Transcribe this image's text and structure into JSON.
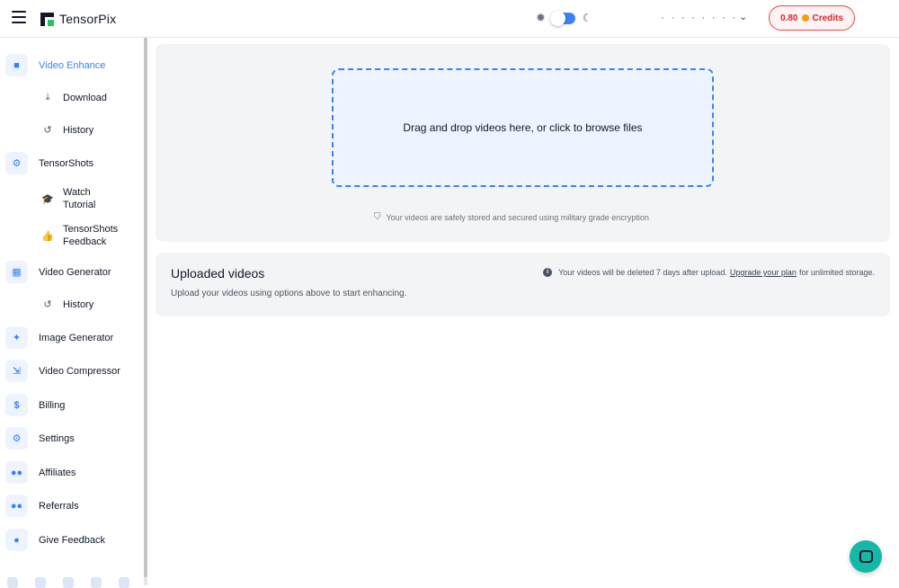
{
  "header": {
    "brand": "TensorPix",
    "user_name": "· · · · · · · ·",
    "credits_amount": "0.80",
    "credits_label": "Credits",
    "theme_mode": "light"
  },
  "sidebar": {
    "items": [
      {
        "label": "Video Enhance",
        "icon": "video-icon",
        "active": true
      },
      {
        "label": "Download",
        "icon": "download-icon"
      },
      {
        "label": "History",
        "icon": "history-icon"
      },
      {
        "label": "TensorShots",
        "icon": "gear-icon"
      },
      {
        "label": "Watch Tutorial",
        "line1": "Watch",
        "line2": "Tutorial",
        "icon": "graduation-cap-icon"
      },
      {
        "label": "TensorShots Feedback",
        "line1": "TensorShots",
        "line2": "Feedback",
        "icon": "thumbs-icon"
      },
      {
        "label": "Video Generator",
        "icon": "film-icon"
      },
      {
        "label": "History",
        "icon": "history-icon"
      },
      {
        "label": "Image Generator",
        "icon": "magic-wand-icon"
      },
      {
        "label": "Video Compressor",
        "icon": "compress-icon"
      },
      {
        "label": "Billing",
        "icon": "dollar-icon"
      },
      {
        "label": "Settings",
        "icon": "settings-icon"
      },
      {
        "label": "Affiliates",
        "icon": "users-icon"
      },
      {
        "label": "Referrals",
        "icon": "user-group-icon"
      },
      {
        "label": "Give Feedback",
        "icon": "chat-bubble-icon"
      }
    ]
  },
  "upload": {
    "dropzone_text": "Drag and drop videos here, or click to browse files",
    "secure_note": "Your videos are safely stored and secured using military grade encryption"
  },
  "uploaded": {
    "title": "Uploaded videos",
    "subtitle": "Upload your videos using options above to start enhancing.",
    "delete_note_prefix": "Your videos will be deleted 7 days after upload.",
    "upgrade_link": "Upgrade your plan",
    "delete_note_suffix": "for unlimited storage."
  },
  "colors": {
    "accent": "#3b82f6",
    "credits": "#dc2626",
    "chat": "#14b8a6"
  }
}
